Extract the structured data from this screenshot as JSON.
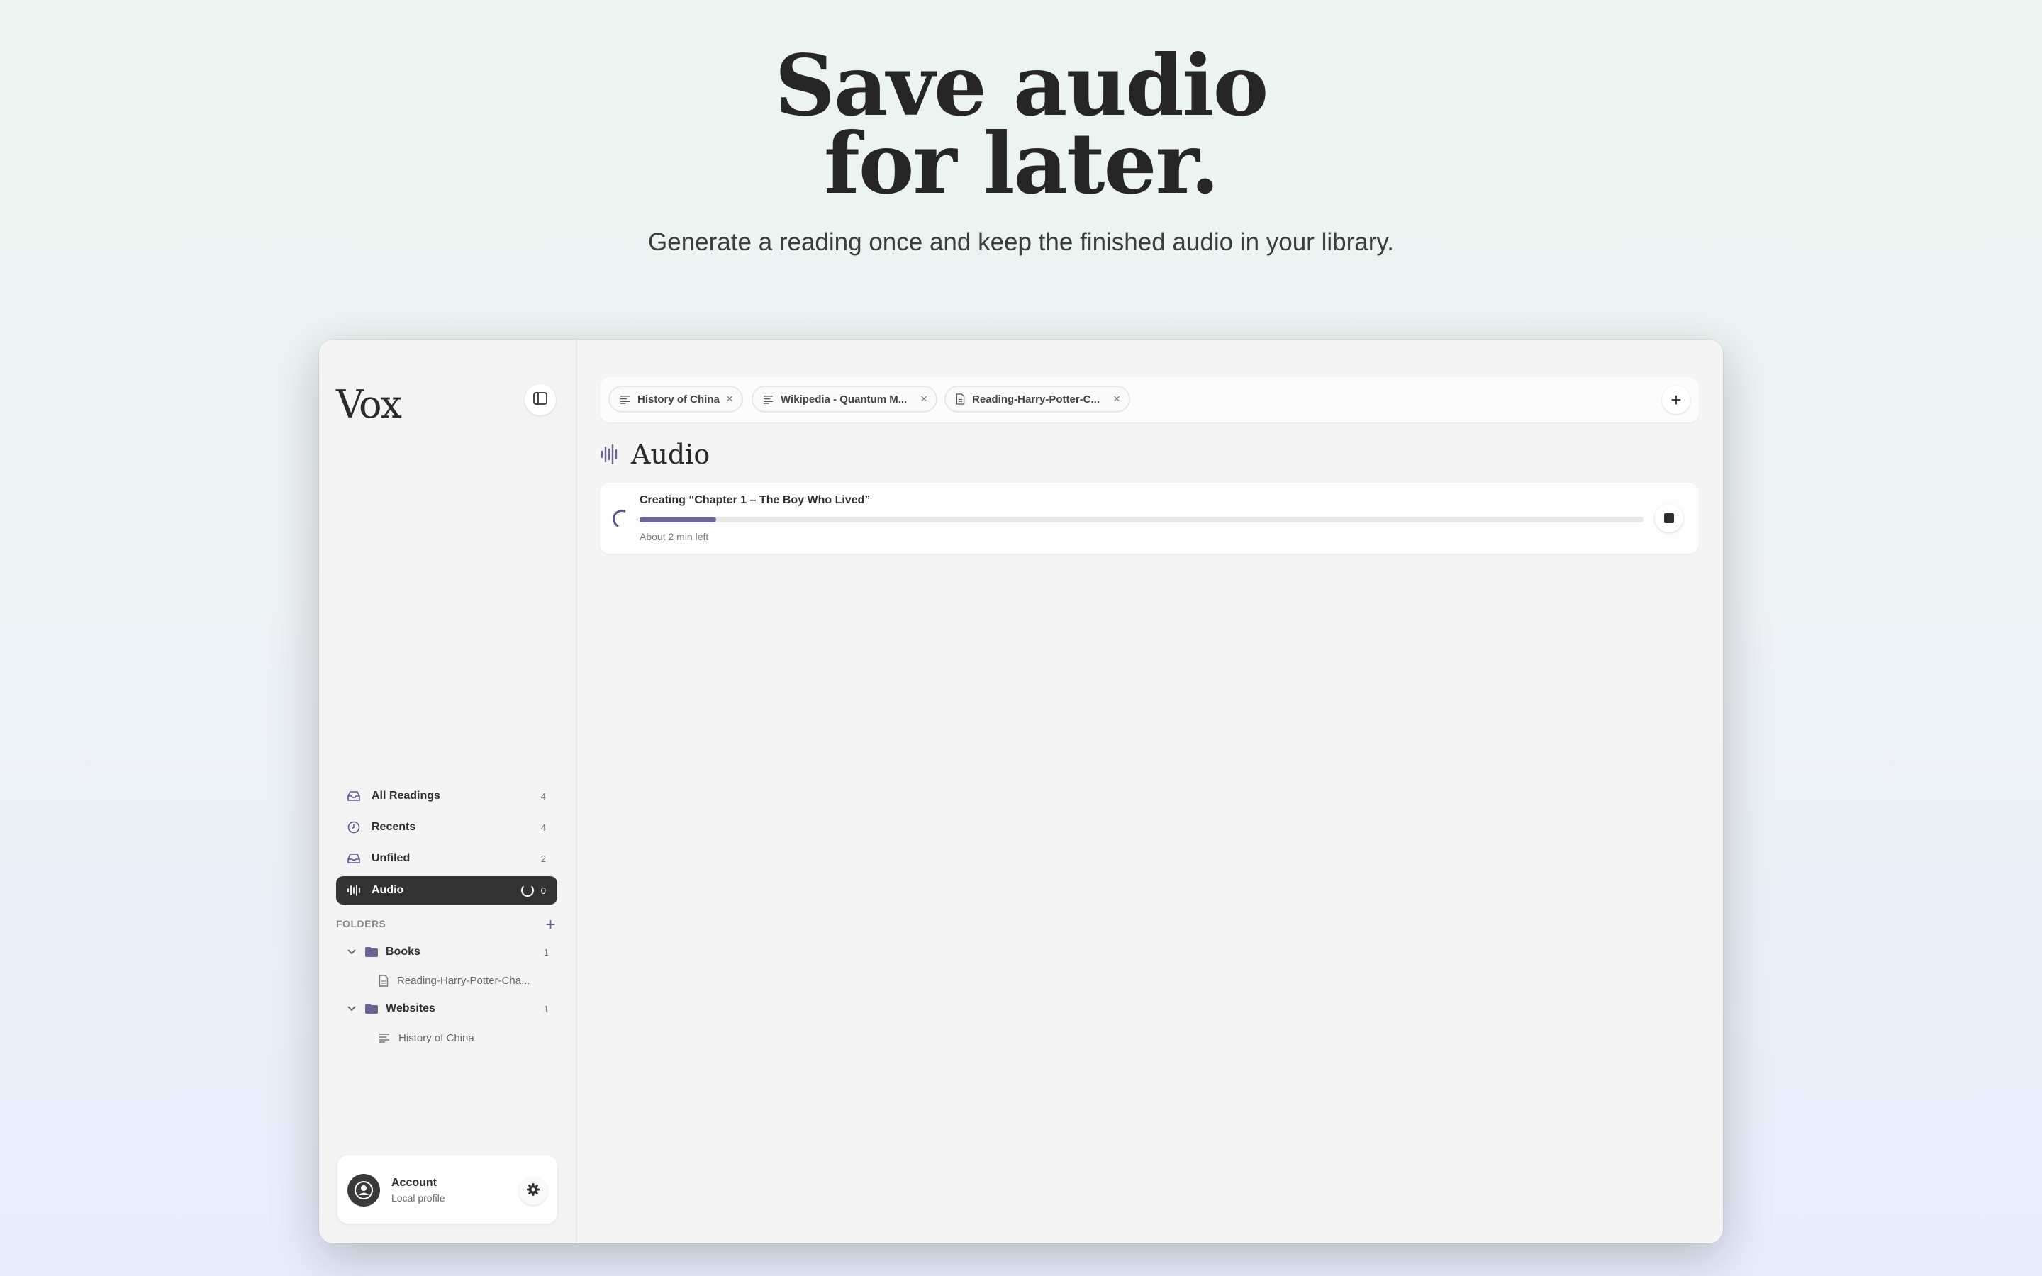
{
  "hero": {
    "title_line1": "Save audio",
    "title_line2": "for later.",
    "subtitle": "Generate a reading once and keep the finished audio in your library."
  },
  "app": {
    "logo": "Vox",
    "sidebar": {
      "nav": [
        {
          "label": "All Readings",
          "count": "4",
          "icon": "tray-icon"
        },
        {
          "label": "Recents",
          "count": "4",
          "icon": "clock-icon"
        },
        {
          "label": "Unfiled",
          "count": "2",
          "icon": "inbox-icon"
        },
        {
          "label": "Audio",
          "count": "0",
          "icon": "waveform-icon",
          "active": true
        }
      ],
      "folders_label": "FOLDERS",
      "folders": [
        {
          "label": "Books",
          "count": "1",
          "items": [
            {
              "label": "Reading-Harry-Potter-Cha...",
              "icon": "document-icon"
            }
          ]
        },
        {
          "label": "Websites",
          "count": "1",
          "items": [
            {
              "label": "History of China",
              "icon": "text-lines-icon"
            }
          ]
        }
      ],
      "account": {
        "name": "Account",
        "subtitle": "Local profile"
      }
    },
    "tabs": [
      {
        "label": "History of China",
        "icon": "text-lines-icon"
      },
      {
        "label": "Wikipedia - Quantum M...",
        "icon": "text-lines-icon"
      },
      {
        "label": "Reading-Harry-Potter-C...",
        "icon": "document-icon"
      }
    ],
    "page_title": "Audio",
    "job": {
      "title": "Creating “Chapter 1 – The Boy Who Lived”",
      "eta": "About 2 min left",
      "progress": 0.076
    },
    "colors": {
      "accent": "#6a6393",
      "active_nav": "#333333"
    }
  }
}
